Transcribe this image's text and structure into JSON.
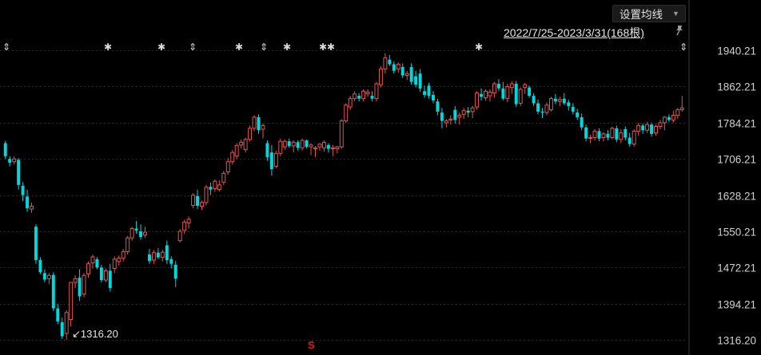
{
  "toolbar": {
    "ma_button_label": "设置均线",
    "range_label": "2022/7/25-2023/3/31(168根)"
  },
  "annotations": {
    "low_label": "↙1316.20",
    "event_markers": [
      "⇕",
      "✱",
      "✱",
      "⇕",
      "✱",
      "⇕",
      "✱",
      "✱✱",
      "✱",
      "⇕"
    ],
    "s_marker": "S"
  },
  "colors": {
    "up": "#e05555",
    "down": "#00d8dc",
    "background": "#000000",
    "grid": "#2a2a2a"
  },
  "chart_data": {
    "type": "candlestick",
    "title": "",
    "date_range": "2022/7/25-2023/3/31",
    "bar_count": 168,
    "ylim": [
      1316.21,
      1970
    ],
    "y_ticks": [
      "1940.21",
      "1862.21",
      "1784.21",
      "1706.21",
      "1628.21",
      "1550.21",
      "1472.21",
      "1394.21",
      "1316.20"
    ],
    "y_tick_values": [
      1940.21,
      1862.21,
      1784.21,
      1706.21,
      1628.21,
      1550.21,
      1472.21,
      1394.21,
      1316.21
    ],
    "grid": true,
    "lowest_annotation": 1316.2,
    "ohlc": [
      [
        1740,
        1745,
        1706,
        1712
      ],
      [
        1706,
        1712,
        1690,
        1698
      ],
      [
        1700,
        1712,
        1694,
        1706
      ],
      [
        1704,
        1708,
        1640,
        1650
      ],
      [
        1648,
        1656,
        1615,
        1628
      ],
      [
        1625,
        1640,
        1592,
        1600
      ],
      [
        1598,
        1612,
        1590,
        1604
      ],
      [
        1560,
        1565,
        1480,
        1488
      ],
      [
        1488,
        1494,
        1458,
        1462
      ],
      [
        1460,
        1468,
        1440,
        1446
      ],
      [
        1448,
        1460,
        1436,
        1455
      ],
      [
        1456,
        1462,
        1378,
        1384
      ],
      [
        1384,
        1394,
        1350,
        1356
      ],
      [
        1354,
        1364,
        1318,
        1324
      ],
      [
        1330,
        1380,
        1316,
        1375
      ],
      [
        1360,
        1440,
        1345,
        1440
      ],
      [
        1440,
        1455,
        1428,
        1448
      ],
      [
        1450,
        1468,
        1400,
        1410
      ],
      [
        1415,
        1460,
        1408,
        1455
      ],
      [
        1458,
        1485,
        1450,
        1480
      ],
      [
        1482,
        1500,
        1470,
        1495
      ],
      [
        1490,
        1495,
        1468,
        1472
      ],
      [
        1472,
        1478,
        1440,
        1445
      ],
      [
        1445,
        1470,
        1440,
        1465
      ],
      [
        1465,
        1480,
        1420,
        1428
      ],
      [
        1470,
        1496,
        1460,
        1490
      ],
      [
        1485,
        1498,
        1476,
        1492
      ],
      [
        1492,
        1512,
        1485,
        1506
      ],
      [
        1506,
        1540,
        1500,
        1536
      ],
      [
        1536,
        1560,
        1530,
        1556
      ],
      [
        1556,
        1572,
        1545,
        1552
      ],
      [
        1550,
        1565,
        1532,
        1538
      ],
      [
        1542,
        1560,
        1536,
        1548
      ],
      [
        1500,
        1512,
        1480,
        1486
      ],
      [
        1488,
        1510,
        1480,
        1504
      ],
      [
        1504,
        1514,
        1490,
        1494
      ],
      [
        1494,
        1510,
        1485,
        1505
      ],
      [
        1520,
        1530,
        1480,
        1488
      ],
      [
        1490,
        1496,
        1470,
        1480
      ],
      [
        1478,
        1486,
        1430,
        1448
      ],
      [
        1530,
        1555,
        1526,
        1550
      ],
      [
        1552,
        1575,
        1545,
        1570
      ],
      [
        1568,
        1582,
        1556,
        1576
      ],
      [
        1606,
        1632,
        1600,
        1628
      ],
      [
        1626,
        1640,
        1598,
        1605
      ],
      [
        1604,
        1616,
        1596,
        1612
      ],
      [
        1612,
        1650,
        1606,
        1645
      ],
      [
        1646,
        1655,
        1628,
        1640
      ],
      [
        1642,
        1662,
        1635,
        1658
      ],
      [
        1640,
        1660,
        1636,
        1650
      ],
      [
        1656,
        1680,
        1650,
        1675
      ],
      [
        1678,
        1708,
        1672,
        1700
      ],
      [
        1700,
        1725,
        1694,
        1720
      ],
      [
        1712,
        1740,
        1706,
        1735
      ],
      [
        1736,
        1748,
        1728,
        1742
      ],
      [
        1726,
        1752,
        1720,
        1748
      ],
      [
        1748,
        1778,
        1744,
        1772
      ],
      [
        1772,
        1800,
        1766,
        1796
      ],
      [
        1796,
        1802,
        1760,
        1768
      ],
      [
        1770,
        1782,
        1750,
        1778
      ],
      [
        1740,
        1746,
        1702,
        1710
      ],
      [
        1720,
        1736,
        1670,
        1684
      ],
      [
        1690,
        1724,
        1686,
        1718
      ],
      [
        1718,
        1750,
        1712,
        1744
      ],
      [
        1732,
        1748,
        1726,
        1744
      ],
      [
        1744,
        1750,
        1730,
        1734
      ],
      [
        1734,
        1746,
        1720,
        1742
      ],
      [
        1742,
        1746,
        1724,
        1730
      ],
      [
        1730,
        1750,
        1724,
        1746
      ],
      [
        1746,
        1748,
        1728,
        1732
      ],
      [
        1732,
        1740,
        1714,
        1736
      ],
      [
        1728,
        1734,
        1710,
        1730
      ],
      [
        1732,
        1740,
        1724,
        1738
      ],
      [
        1730,
        1746,
        1722,
        1742
      ],
      [
        1736,
        1740,
        1720,
        1728
      ],
      [
        1728,
        1736,
        1712,
        1730
      ],
      [
        1728,
        1734,
        1718,
        1732
      ],
      [
        1732,
        1792,
        1728,
        1788
      ],
      [
        1788,
        1826,
        1784,
        1822
      ],
      [
        1818,
        1842,
        1812,
        1836
      ],
      [
        1836,
        1852,
        1830,
        1846
      ],
      [
        1842,
        1848,
        1830,
        1836
      ],
      [
        1836,
        1856,
        1830,
        1852
      ],
      [
        1846,
        1856,
        1840,
        1850
      ],
      [
        1842,
        1852,
        1830,
        1836
      ],
      [
        1836,
        1872,
        1830,
        1868
      ],
      [
        1866,
        1906,
        1860,
        1900
      ],
      [
        1900,
        1934,
        1890,
        1924
      ],
      [
        1920,
        1930,
        1906,
        1910
      ],
      [
        1910,
        1916,
        1890,
        1896
      ],
      [
        1900,
        1914,
        1892,
        1910
      ],
      [
        1904,
        1912,
        1880,
        1886
      ],
      [
        1886,
        1896,
        1876,
        1890
      ],
      [
        1904,
        1912,
        1866,
        1872
      ],
      [
        1884,
        1896,
        1860,
        1866
      ],
      [
        1890,
        1900,
        1850,
        1858
      ],
      [
        1852,
        1864,
        1838,
        1844
      ],
      [
        1864,
        1870,
        1836,
        1842
      ],
      [
        1844,
        1852,
        1826,
        1832
      ],
      [
        1830,
        1836,
        1800,
        1808
      ],
      [
        1806,
        1816,
        1772,
        1788
      ],
      [
        1784,
        1792,
        1774,
        1788
      ],
      [
        1790,
        1800,
        1780,
        1792
      ],
      [
        1812,
        1820,
        1782,
        1790
      ],
      [
        1796,
        1806,
        1780,
        1800
      ],
      [
        1802,
        1816,
        1792,
        1810
      ],
      [
        1810,
        1818,
        1796,
        1806
      ],
      [
        1808,
        1820,
        1794,
        1816
      ],
      [
        1818,
        1852,
        1812,
        1848
      ],
      [
        1846,
        1858,
        1832,
        1840
      ],
      [
        1838,
        1856,
        1832,
        1852
      ],
      [
        1842,
        1856,
        1830,
        1850
      ],
      [
        1848,
        1872,
        1838,
        1868
      ],
      [
        1868,
        1878,
        1852,
        1858
      ],
      [
        1858,
        1872,
        1832,
        1836
      ],
      [
        1836,
        1868,
        1828,
        1862
      ],
      [
        1860,
        1874,
        1846,
        1868
      ],
      [
        1868,
        1874,
        1818,
        1824
      ],
      [
        1826,
        1860,
        1820,
        1856
      ],
      [
        1860,
        1870,
        1846,
        1866
      ],
      [
        1860,
        1864,
        1838,
        1842
      ],
      [
        1842,
        1848,
        1820,
        1826
      ],
      [
        1826,
        1834,
        1802,
        1808
      ],
      [
        1808,
        1816,
        1794,
        1806
      ],
      [
        1806,
        1828,
        1800,
        1822
      ],
      [
        1812,
        1840,
        1808,
        1836
      ],
      [
        1836,
        1846,
        1824,
        1830
      ],
      [
        1830,
        1840,
        1820,
        1834
      ],
      [
        1836,
        1848,
        1822,
        1826
      ],
      [
        1828,
        1834,
        1810,
        1820
      ],
      [
        1818,
        1826,
        1802,
        1808
      ],
      [
        1806,
        1814,
        1790,
        1796
      ],
      [
        1796,
        1804,
        1768,
        1774
      ],
      [
        1774,
        1780,
        1744,
        1750
      ],
      [
        1750,
        1758,
        1740,
        1752
      ],
      [
        1752,
        1770,
        1746,
        1766
      ],
      [
        1766,
        1772,
        1744,
        1750
      ],
      [
        1752,
        1764,
        1744,
        1760
      ],
      [
        1760,
        1768,
        1746,
        1752
      ],
      [
        1752,
        1776,
        1748,
        1772
      ],
      [
        1772,
        1778,
        1742,
        1748
      ],
      [
        1748,
        1770,
        1740,
        1762
      ],
      [
        1770,
        1776,
        1746,
        1752
      ],
      [
        1752,
        1762,
        1732,
        1738
      ],
      [
        1738,
        1770,
        1732,
        1766
      ],
      [
        1766,
        1784,
        1756,
        1778
      ],
      [
        1778,
        1782,
        1760,
        1768
      ],
      [
        1768,
        1786,
        1762,
        1780
      ],
      [
        1780,
        1784,
        1754,
        1760
      ],
      [
        1762,
        1780,
        1756,
        1776
      ],
      [
        1776,
        1790,
        1770,
        1784
      ],
      [
        1784,
        1798,
        1768,
        1796
      ],
      [
        1796,
        1802,
        1786,
        1790
      ],
      [
        1790,
        1810,
        1784,
        1800
      ],
      [
        1800,
        1816,
        1792,
        1812
      ],
      [
        1812,
        1842,
        1808,
        1816
      ]
    ]
  }
}
